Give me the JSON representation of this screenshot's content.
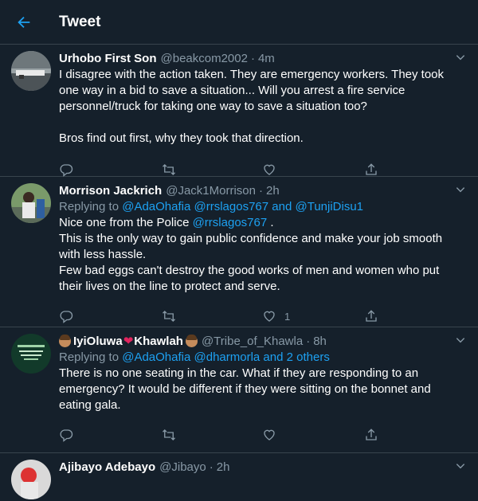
{
  "header": {
    "title": "Tweet"
  },
  "tweets": [
    {
      "name": "Urhobo First Son",
      "handle": "@beakcom2002",
      "time": "4m",
      "body": [
        "I disagree with the action taken. They are emergency workers. They took one way in a bid to save a situation... Will you arrest a fire service personnel/truck for taking one way to save a situation too?",
        "",
        "Bros find out first, why they took that direction."
      ]
    },
    {
      "name": "Morrison Jackrich",
      "handle": "@Jack1Morrison",
      "time": "2h",
      "replying_prefix": "Replying to ",
      "replying_mentions": "@AdaOhafia @rrslagos767",
      "replying_and": " and ",
      "replying_last": "@TunjiDisu1",
      "line1_prefix": "Nice one from the Police ",
      "line1_mention": "@rrslagos767",
      "line1_suffix": " .",
      "body": [
        "This is the only way to gain public confidence and make your job smooth with less hassle.",
        "Few bad eggs can't destroy the good works of men and women who put their lives on the line to protect and serve."
      ],
      "like_count": "1"
    },
    {
      "name_part1": "IyiOluwa",
      "name_part2": "Khawlah",
      "handle": "@Tribe_of_Khawla",
      "time": "8h",
      "replying_prefix": "Replying to ",
      "replying_mentions": "@AdaOhafia @dharmorla",
      "replying_and": " and ",
      "replying_last": "2 others",
      "body": [
        "There is no one seating in the car. What if they are responding to an emergency? It would be different if they were sitting on the bonnet and eating gala."
      ]
    },
    {
      "name": "Ajibayo Adebayo",
      "handle": "@Jibayo",
      "time": "2h"
    }
  ],
  "colors": {
    "background": "#15202b",
    "accent": "#1da1f2",
    "muted": "#8899a6",
    "border": "#38444d"
  },
  "icons": [
    "back-arrow-icon",
    "chevron-down-icon",
    "reply-icon",
    "retweet-icon",
    "like-icon",
    "share-icon"
  ]
}
